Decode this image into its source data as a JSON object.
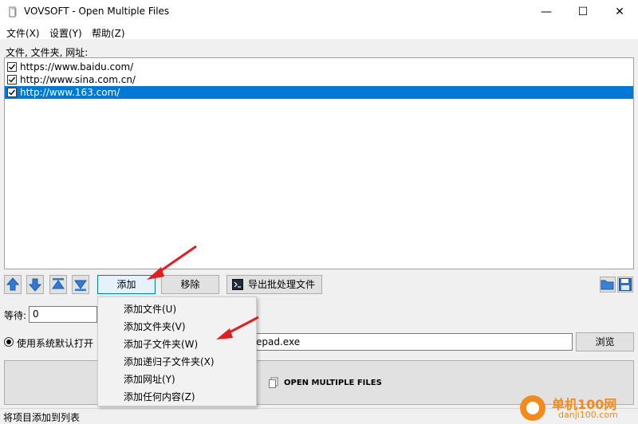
{
  "window": {
    "title": "VOVSOFT - Open Multiple Files",
    "minimize": "—",
    "maximize": "☐",
    "close": "✕"
  },
  "menu": [
    {
      "label": "文件(X)"
    },
    {
      "label": "设置(Y)"
    },
    {
      "label": "帮助(Z)"
    }
  ],
  "list": {
    "label": "文件, 文件夹, 网址:",
    "items": [
      {
        "text": "https://www.baidu.com/",
        "checked": true,
        "selected": false
      },
      {
        "text": "http://www.sina.com.cn/",
        "checked": true,
        "selected": false
      },
      {
        "text": "http://www.163.com/",
        "checked": true,
        "selected": true
      }
    ]
  },
  "toolbar": {
    "move_up": "arrow-up-icon",
    "move_down": "arrow-down-icon",
    "move_top": "arrow-top-icon",
    "move_bottom": "arrow-bottom-icon",
    "add_label": "添加",
    "remove_label": "移除",
    "export_label": "导出批处理文件",
    "open_list": "folder-open-icon",
    "save_list": "save-icon"
  },
  "wait": {
    "label": "等待:",
    "value": "0"
  },
  "open_with": {
    "radio_label": "使用系统默认打开",
    "path_fragment": "epad.exe",
    "browse_label": "浏览"
  },
  "main_button": {
    "label": "OPEN MULTIPLE FILES"
  },
  "dropdown": {
    "items": [
      {
        "label": "添加文件(U)"
      },
      {
        "label": "添加文件夹(V)"
      },
      {
        "label": "添加子文件夹(W)"
      },
      {
        "label": "添加递归子文件夹(X)"
      },
      {
        "label": "添加网址(Y)"
      },
      {
        "label": "添加任何内容(Z)"
      }
    ]
  },
  "status": {
    "text": "将项目添加到列表"
  },
  "watermark": {
    "brand": "单机100网",
    "url": "danji100.com"
  },
  "colors": {
    "selection": "#0078d7",
    "annotation_arrow": "#e02020",
    "toolbar_arrow": "#2e7bd6"
  }
}
